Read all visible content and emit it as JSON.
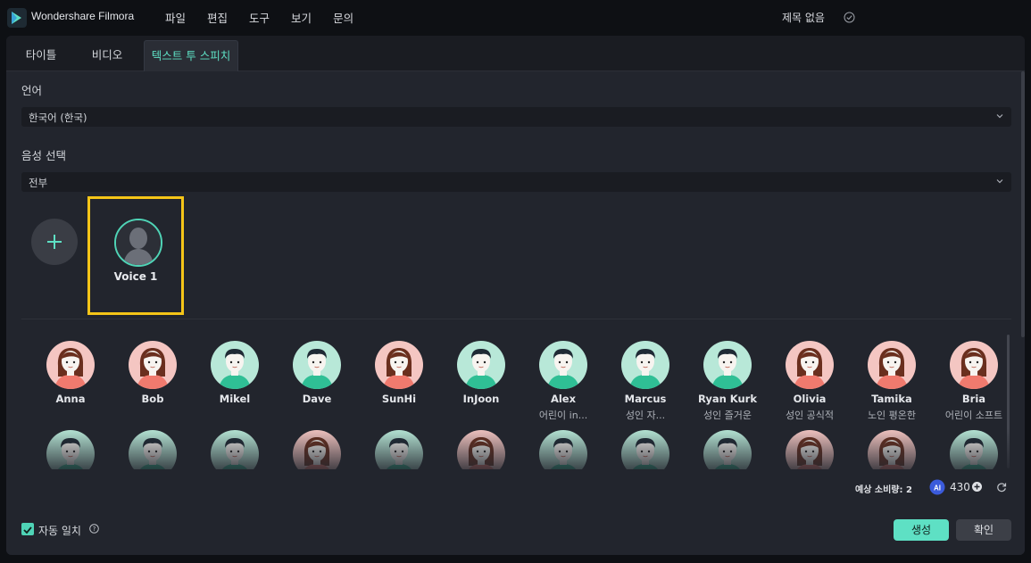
{
  "app": {
    "name": "Wondershare Filmora",
    "menu": [
      "파일",
      "편집",
      "도구",
      "보기",
      "문의"
    ],
    "project_title": "제목 없음"
  },
  "tabs": [
    {
      "label": "타이틀"
    },
    {
      "label": "비디오"
    },
    {
      "label": "텍스트 투 스피치",
      "active": true
    }
  ],
  "language": {
    "label": "언어",
    "value": "한국어 (한국)"
  },
  "voice_select": {
    "label": "음성 선택",
    "value": "전부"
  },
  "custom_voice": {
    "name": "Voice 1"
  },
  "voices": [
    {
      "name": "Anna",
      "desc": "",
      "gender": "female"
    },
    {
      "name": "Bob",
      "desc": "",
      "gender": "female"
    },
    {
      "name": "Mikel",
      "desc": "",
      "gender": "male"
    },
    {
      "name": "Dave",
      "desc": "",
      "gender": "male"
    },
    {
      "name": "SunHi",
      "desc": "",
      "gender": "female"
    },
    {
      "name": "InJoon",
      "desc": "",
      "gender": "male"
    },
    {
      "name": "Alex",
      "desc": "어린이 in...",
      "gender": "male"
    },
    {
      "name": "Marcus",
      "desc": "성인 자...",
      "gender": "male"
    },
    {
      "name": "Ryan Kurk",
      "desc": "성인 즐거운",
      "gender": "male"
    },
    {
      "name": "Olivia",
      "desc": "성인 공식적",
      "gender": "female"
    },
    {
      "name": "Tamika",
      "desc": "노인 평온한",
      "gender": "female"
    },
    {
      "name": "Bria",
      "desc": "어린이 소프트",
      "gender": "female"
    }
  ],
  "voices_row2": [
    "male",
    "male",
    "male",
    "female",
    "male",
    "female",
    "male",
    "male",
    "male",
    "female",
    "female",
    "male"
  ],
  "footer": {
    "usage_label": "예상 소비량: 2",
    "credits": "430",
    "auto_match_label": "자동 일치",
    "generate_label": "생성",
    "confirm_label": "확인"
  },
  "colors": {
    "accent": "#5ee0c4",
    "highlight_box": "#f5c518",
    "female_bg": "#f4c6c2",
    "male_bg": "#b8e8d8"
  },
  "icons": [
    "filmora-logo-icon",
    "check-circle-icon",
    "chevron-down-icon",
    "plus-icon",
    "ai-credit-icon",
    "refresh-icon",
    "help-icon",
    "checkbox-icon"
  ]
}
